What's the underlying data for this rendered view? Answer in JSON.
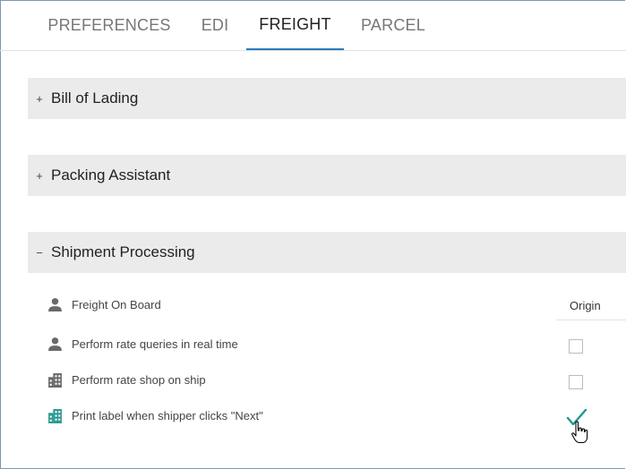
{
  "tabs": [
    {
      "label": "PREFERENCES"
    },
    {
      "label": "EDI"
    },
    {
      "label": "FREIGHT",
      "active": true
    },
    {
      "label": "PARCEL"
    }
  ],
  "panels": [
    {
      "title": "Bill of Lading",
      "toggle": "+",
      "expanded": false
    },
    {
      "title": "Packing Assistant",
      "toggle": "+",
      "expanded": false
    },
    {
      "title": "Shipment Processing",
      "toggle": "−",
      "expanded": true
    }
  ],
  "shipment_processing": {
    "column_header": "Origin",
    "rows": [
      {
        "label": "Freight On Board",
        "icon": "person-icon"
      },
      {
        "label": "Perform rate queries in real time",
        "icon": "person-icon",
        "checked": false
      },
      {
        "label": "Perform rate shop on ship",
        "icon": "building-icon",
        "checked": false
      },
      {
        "label": "Print label when shipper clicks \"Next\"",
        "icon": "building-icon",
        "checked": true
      }
    ]
  },
  "colors": {
    "accent": "#2a79b8",
    "check": "#1a9a8a",
    "icon_gray": "#6a6a6a",
    "icon_teal": "#2a9a90",
    "panel_bg": "#ebebeb"
  }
}
